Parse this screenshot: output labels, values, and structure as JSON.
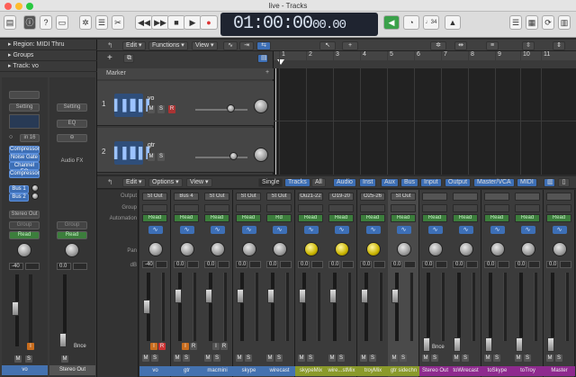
{
  "window": {
    "title": "live - Tracks"
  },
  "lcd": {
    "time": "01:00:00",
    "frames": "00.00"
  },
  "transport": {
    "rewind": "◀◀",
    "forward": "▶▶",
    "stop": "■",
    "play": "▶"
  },
  "toolbar": {
    "count_in": "♩34"
  },
  "inspector": {
    "region_label": "Region: MIDI Thru",
    "groups_label": "Groups",
    "track_label": "Track: vo",
    "setting": "Setting",
    "eq": "EQ",
    "input": "in 16",
    "plugins": [
      "Compressor",
      "Noise Gate",
      "Channel EQ",
      "Compressor"
    ],
    "sends": [
      "Bus 1",
      "Bus 2"
    ],
    "output": "Stereo Out",
    "group": "Group",
    "auto": "Read",
    "db_left": "-40",
    "db_right": "0.0",
    "audio_fx": "Audio FX",
    "bnce": "Bnce",
    "name_left": "vo",
    "name_right": "Stereo Out"
  },
  "tracks_toolbar": {
    "edit": "Edit ▾",
    "functions": "Functions ▾",
    "view": "View ▾",
    "marker": "Marker"
  },
  "ruler": [
    "1",
    "2",
    "3",
    "4",
    "5",
    "6",
    "7",
    "8",
    "9",
    "10",
    "11"
  ],
  "tracks": [
    {
      "num": "1",
      "name": "vo",
      "m": "M",
      "s": "S",
      "r": "R"
    },
    {
      "num": "2",
      "name": "gtr",
      "m": "M",
      "s": "S"
    }
  ],
  "mixer_toolbar": {
    "edit": "Edit ▾",
    "options": "Options ▾",
    "view": "View ▾",
    "single": "Single",
    "tracks": "Tracks",
    "all": "All",
    "filters": [
      "Audio",
      "Inst",
      "Aux",
      "Bus",
      "Input",
      "Output",
      "Master/VCA",
      "MIDI"
    ]
  },
  "mixer_labels": {
    "output": "Output",
    "group": "Group",
    "automation": "Automation",
    "pan": "Pan",
    "db": "dB"
  },
  "strips": [
    {
      "name": "vo",
      "output": "St Out",
      "auto": "Read",
      "db": "-40",
      "name_color": "#4472b0"
    },
    {
      "name": "gtr",
      "output": "Bus 4",
      "auto": "Read",
      "db": "0.0",
      "name_color": "#4472b0"
    },
    {
      "name": "macmini",
      "output": "St Out",
      "auto": "Read",
      "db": "0.0",
      "name_color": "#4472b0"
    },
    {
      "name": "skype",
      "output": "St Out",
      "auto": "Read",
      "db": "0.0",
      "name_color": "#4472b0"
    },
    {
      "name": "wirecast",
      "output": "St Out",
      "auto": "Rd",
      "db": "0.0",
      "name_color": "#4472b0"
    },
    {
      "name": "skypeMix",
      "output": "Ou21-22",
      "auto": "Read",
      "db": "0.0",
      "name_color": "#8a9a2a"
    },
    {
      "name": "wire...stMix",
      "output": "O19-20",
      "auto": "Read",
      "db": "0.0",
      "name_color": "#8a9a2a"
    },
    {
      "name": "troyMix",
      "output": "O25-26",
      "auto": "Read",
      "db": "0.0",
      "name_color": "#8a9a2a"
    },
    {
      "name": "gtr sidechn",
      "output": "St Out",
      "auto": "Read",
      "db": "0.0",
      "name_color": "#8a9a2a"
    },
    {
      "name": "Stereo Out",
      "output": "",
      "auto": "Read",
      "db": "0.0",
      "name_color": "#8e2a8e"
    },
    {
      "name": "toWirecast",
      "output": "",
      "auto": "Read",
      "db": "0.0",
      "name_color": "#8e2a8e"
    },
    {
      "name": "toSkype",
      "output": "",
      "auto": "Read",
      "db": "0.0",
      "name_color": "#8e2a8e"
    },
    {
      "name": "toTroy",
      "output": "",
      "auto": "Read",
      "db": "0.0",
      "name_color": "#8e2a8e"
    },
    {
      "name": "Master",
      "output": "",
      "auto": "Read",
      "db": "0.0",
      "name_color": "#8e2a8e"
    }
  ],
  "master_bnce": "Bnce"
}
